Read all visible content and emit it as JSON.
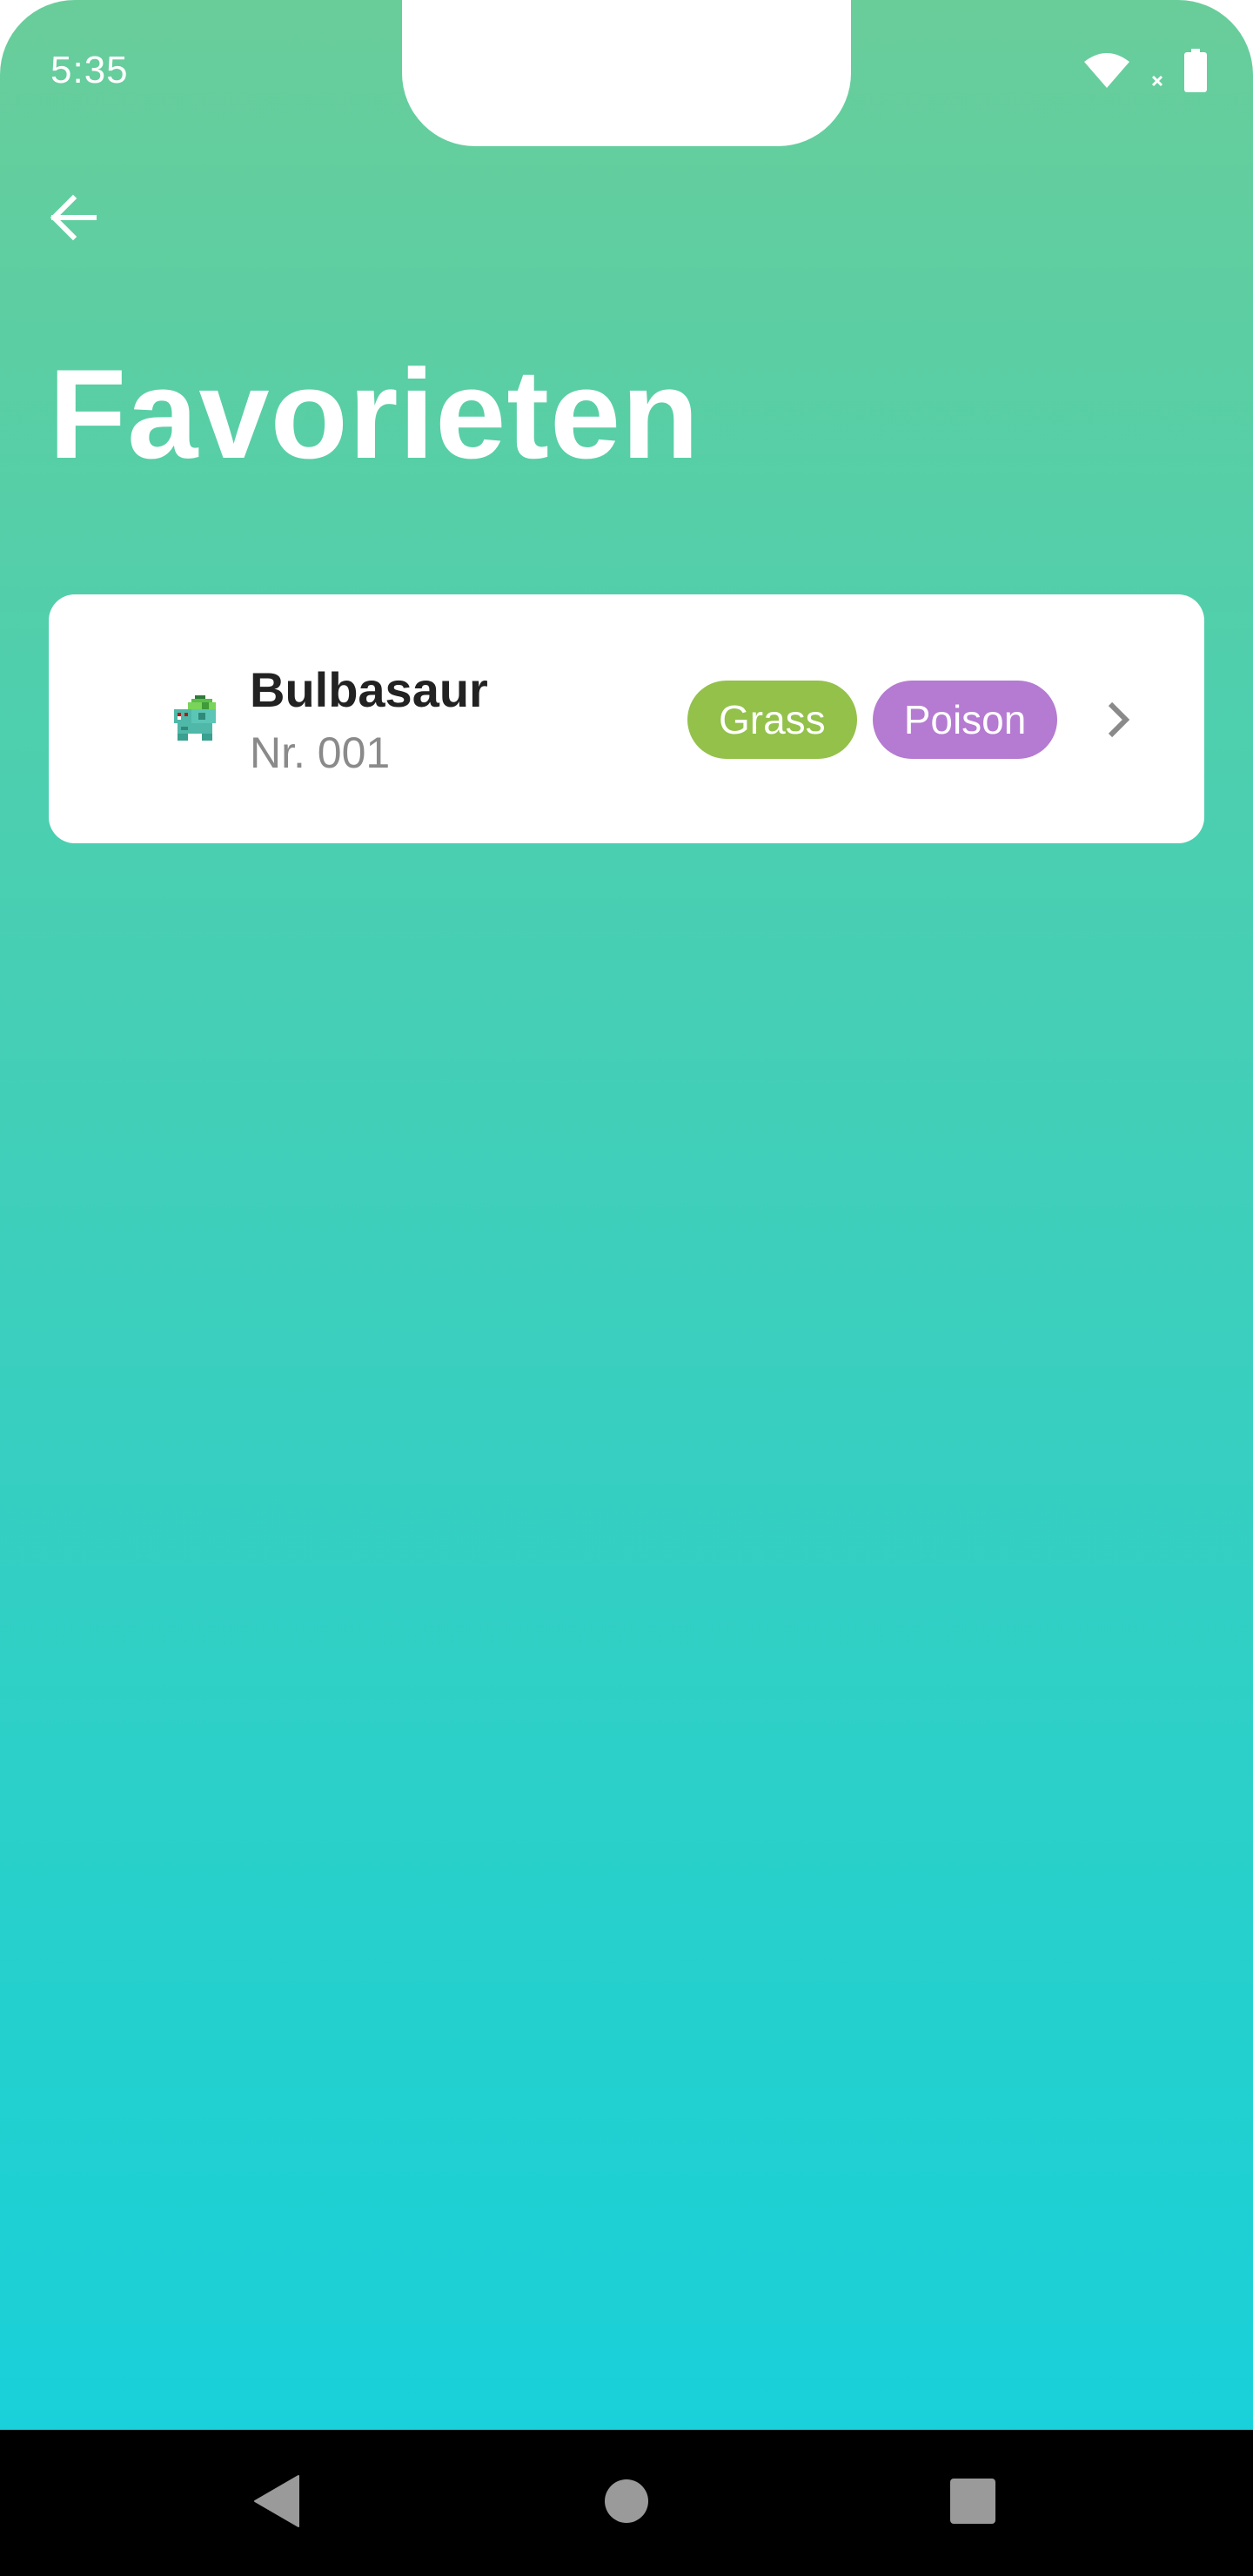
{
  "status_bar": {
    "time": "5:35",
    "icons": [
      "wifi-icon",
      "no-sim-icon",
      "battery-icon"
    ]
  },
  "header": {
    "back_icon": "arrow-left-icon",
    "title": "Favorieten"
  },
  "favorites": [
    {
      "name": "Bulbasaur",
      "number": "Nr. 001",
      "sprite_icon": "bulbasaur-sprite-icon",
      "types": [
        {
          "label": "Grass",
          "color": "#93c14a"
        },
        {
          "label": "Poison",
          "color": "#b57ad1"
        }
      ]
    }
  ],
  "nav_bar": {
    "buttons": [
      "back-triangle-icon",
      "home-circle-icon",
      "recents-square-icon"
    ]
  },
  "colors": {
    "gradient_top": "#69cd9a",
    "gradient_bottom": "#16d0de",
    "card_bg": "#ffffff",
    "nav_bar": "#000000"
  }
}
